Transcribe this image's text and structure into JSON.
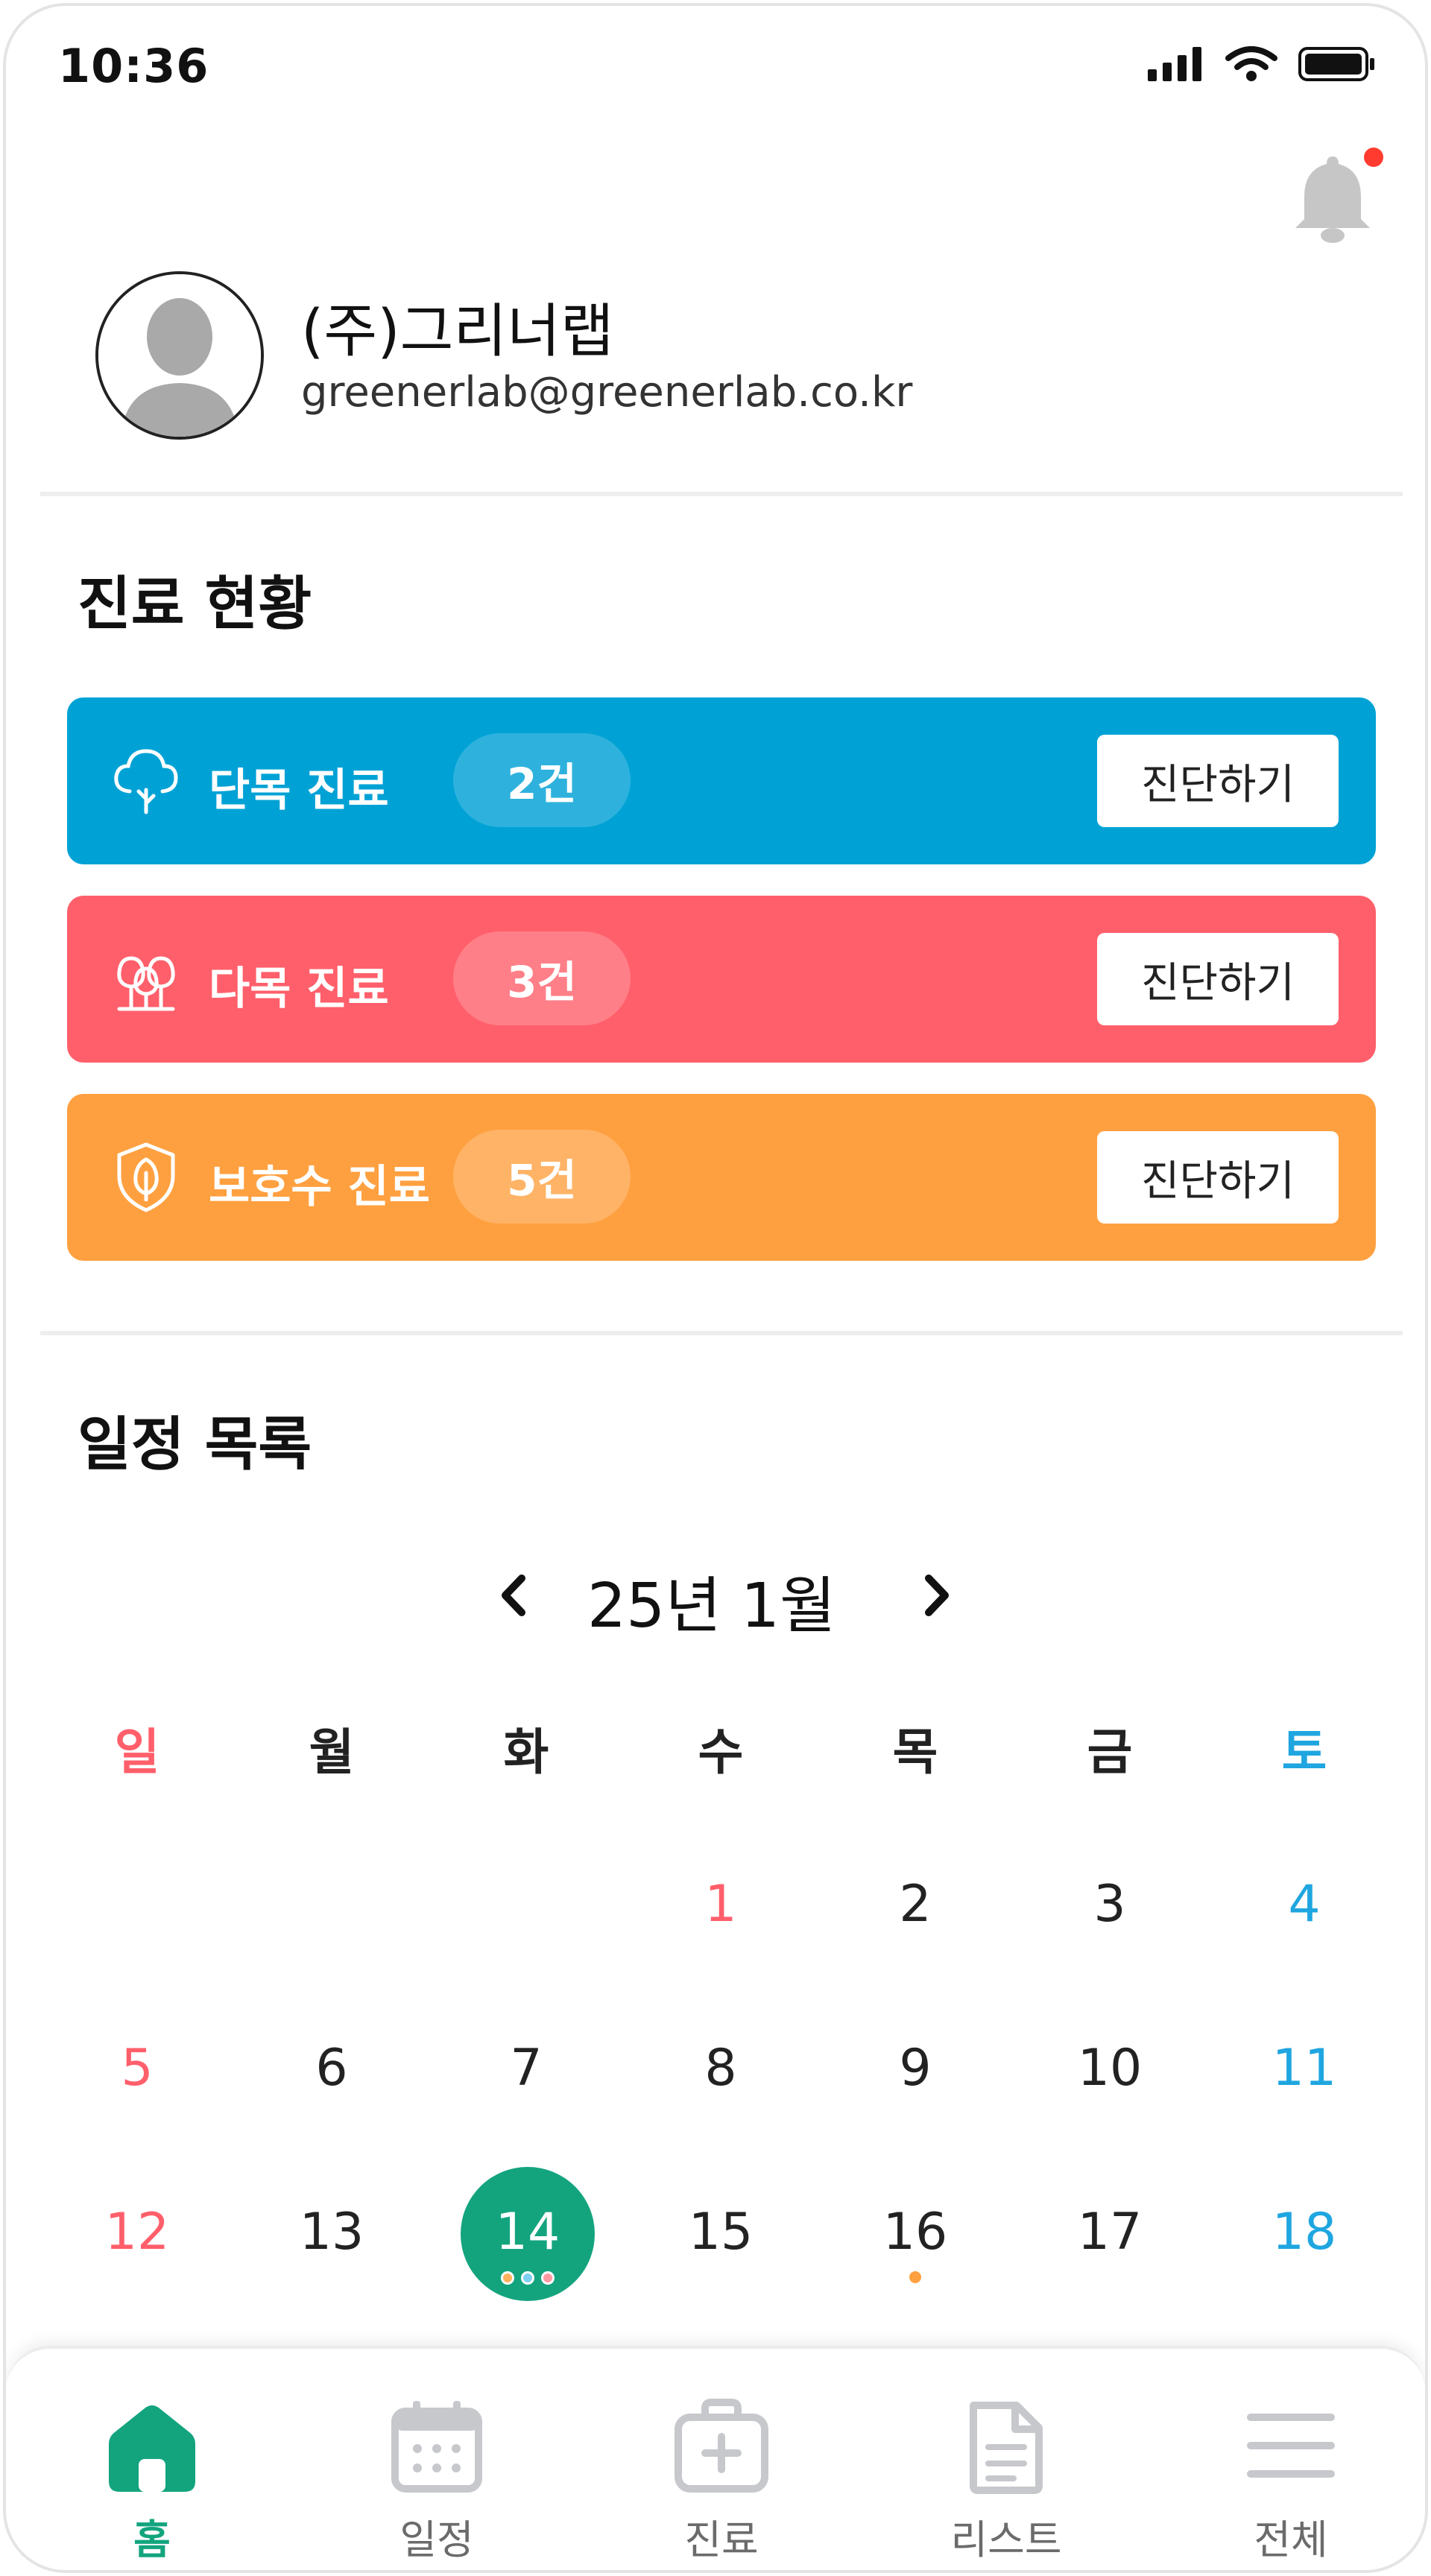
{
  "status_bar": {
    "time": "10:36"
  },
  "profile": {
    "name": "(주)그리너랩",
    "email": "greenerlab@greenerlab.co.kr"
  },
  "clinic": {
    "title": "진료 현황",
    "items": [
      {
        "label": "단목 진료",
        "count": "2건",
        "button": "진단하기",
        "color": "#00a2d6",
        "icon": "tree-icon"
      },
      {
        "label": "다목 진료",
        "count": "3건",
        "button": "진단하기",
        "color": "#ff5f6b",
        "icon": "trees-icon"
      },
      {
        "label": "보호수 진료",
        "count": "5건",
        "button": "진단하기",
        "color": "#ffa040",
        "icon": "shield-leaf-icon"
      }
    ]
  },
  "schedule": {
    "title": "일정 목록",
    "month": "25년 1월",
    "weekdays": [
      "일",
      "월",
      "화",
      "수",
      "목",
      "금",
      "토"
    ],
    "days": [
      "1",
      "2",
      "3",
      "4",
      "5",
      "6",
      "7",
      "8",
      "9",
      "10",
      "11",
      "12",
      "13",
      "14",
      "15",
      "16",
      "17",
      "18"
    ],
    "today": "14",
    "event_dot_colors": [
      "#ffb35c",
      "#7fd0f0",
      "#ff9aa2"
    ]
  },
  "bottom_nav": {
    "items": [
      {
        "label": "홈",
        "icon": "home-icon",
        "active": true
      },
      {
        "label": "일정",
        "icon": "calendar-icon",
        "active": false
      },
      {
        "label": "진료",
        "icon": "medical-kit-icon",
        "active": false
      },
      {
        "label": "리스트",
        "icon": "document-icon",
        "active": false
      },
      {
        "label": "전체",
        "icon": "menu-icon",
        "active": false
      }
    ]
  },
  "colors": {
    "primary": "#13a47e",
    "sunday": "#ff5f6b",
    "saturday": "#1fa6e0",
    "notification": "#ff3b30"
  }
}
